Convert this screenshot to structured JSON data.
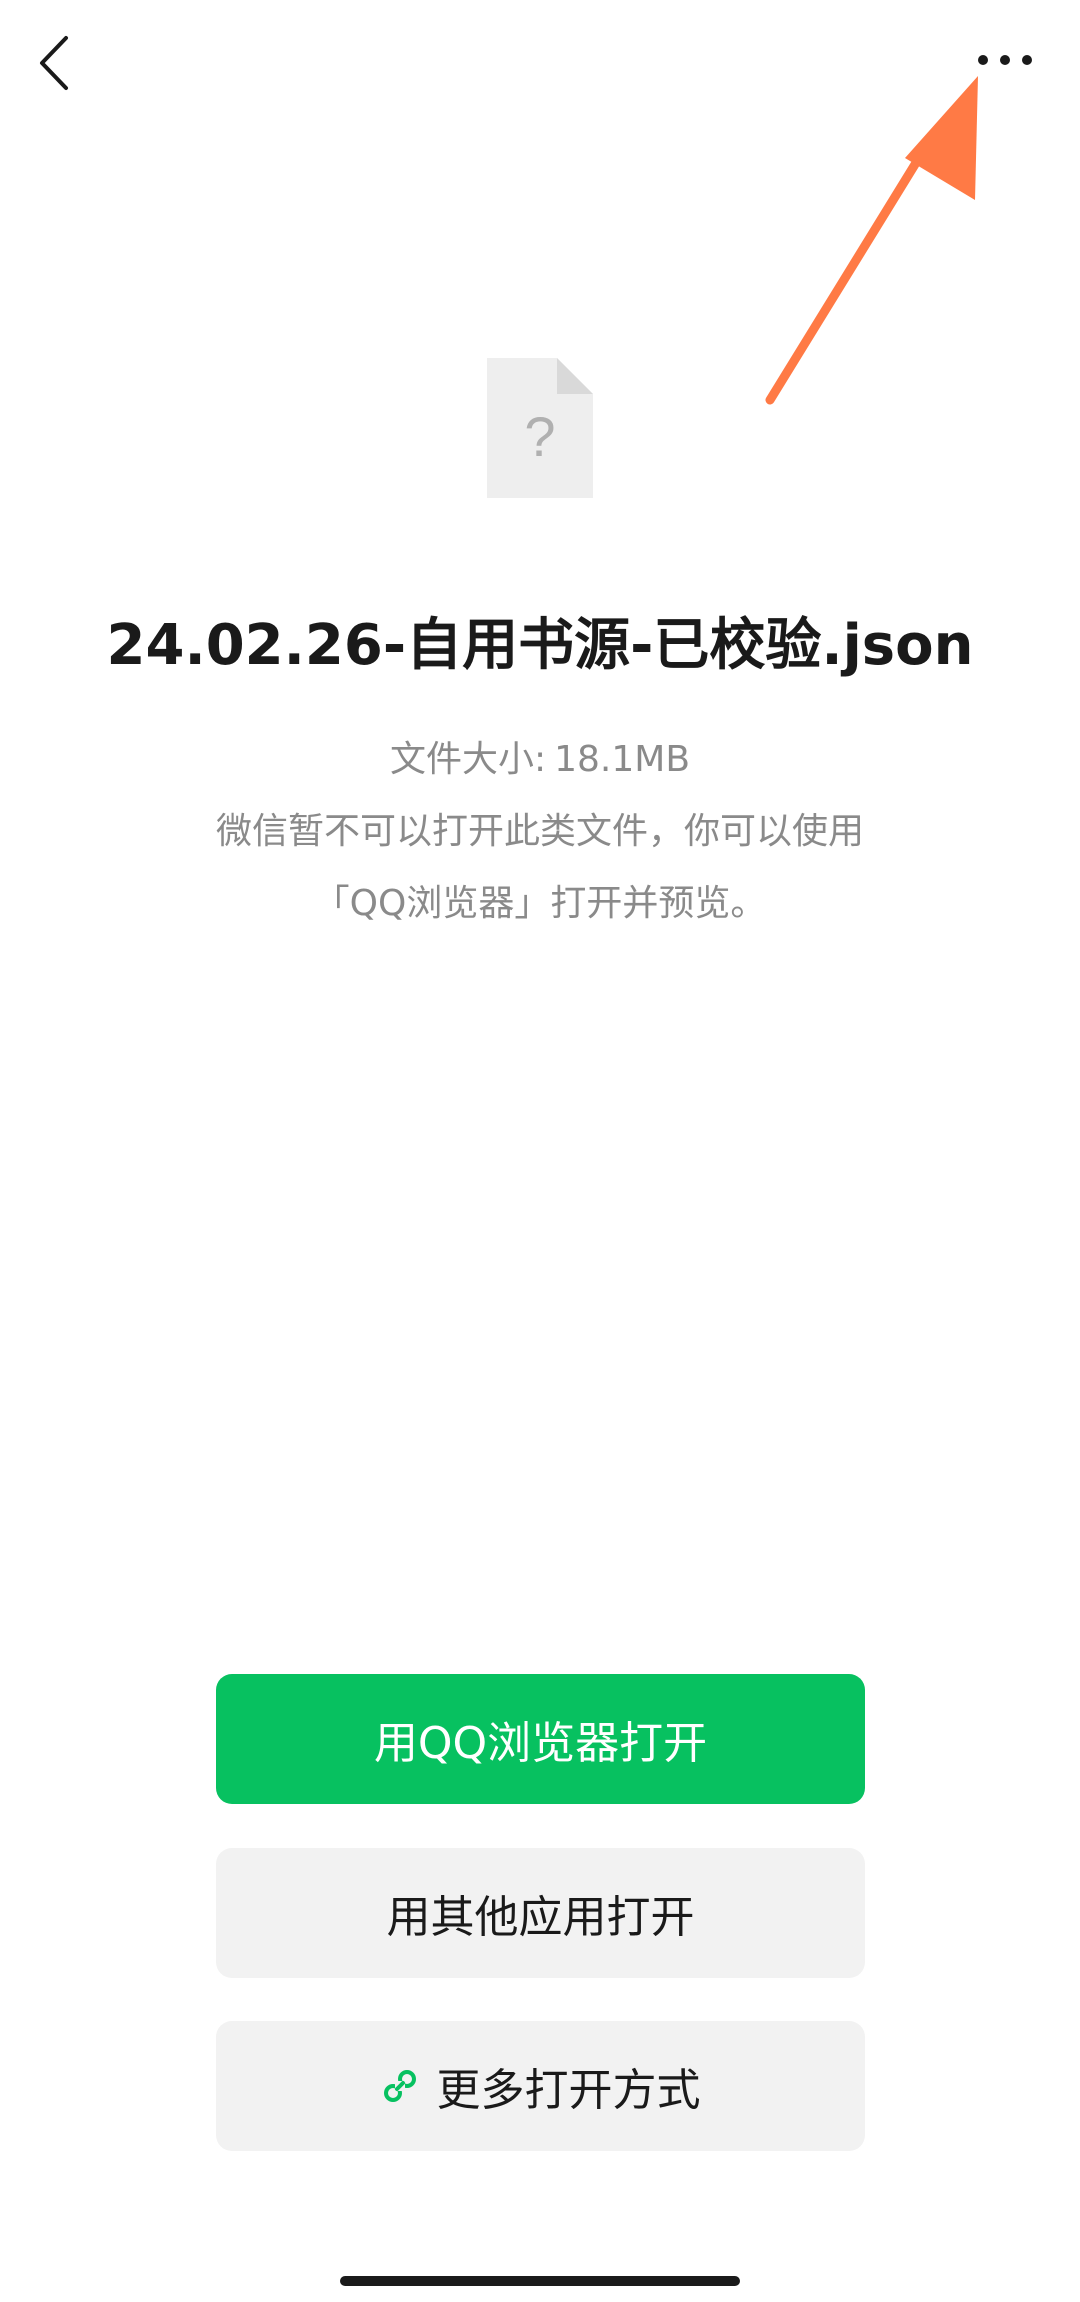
{
  "nav": {
    "back_icon": "chevron-left-icon",
    "more_icon": "more-horizontal-icon"
  },
  "annotation": {
    "arrow_color": "#ff7a45"
  },
  "file": {
    "icon": "unknown-file-icon",
    "name": "24.02.26-自用书源-已校验.json",
    "size_label": "文件大小:",
    "size_value": "18.1MB"
  },
  "notice": {
    "line1": "微信暂不可以打开此类文件，你可以使用",
    "line2": "「QQ浏览器」打开并预览。"
  },
  "actions": {
    "primary_label": "用QQ浏览器打开",
    "secondary_label": "用其他应用打开",
    "more_label": "更多打开方式",
    "more_icon": "link-icon"
  },
  "colors": {
    "primary": "#07c160",
    "secondary_bg": "#f2f2f2",
    "text_primary": "#1a1a1a",
    "text_secondary": "#8a8a8a"
  }
}
